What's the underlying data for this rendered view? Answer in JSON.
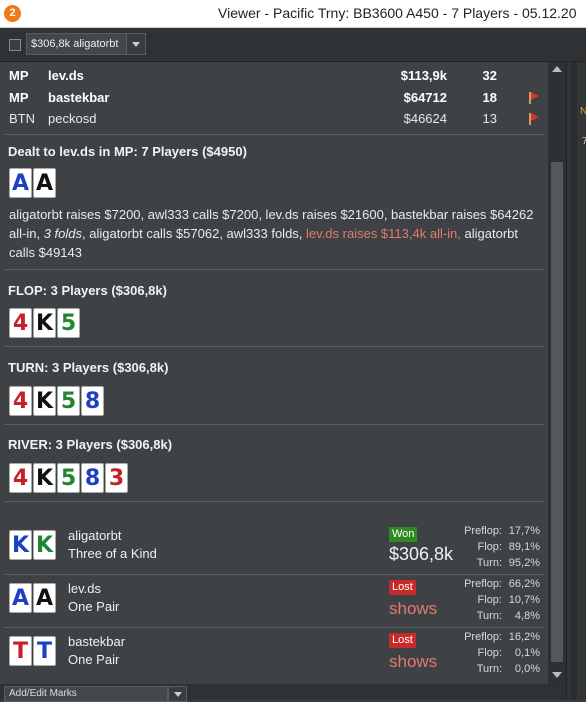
{
  "window": {
    "title": "Viewer - Pacific Trny: BB3600 A450 - 7 Players - 05.12.20",
    "app_icon": "2"
  },
  "toolbar": {
    "player_select": "$306,8k aligatorbt"
  },
  "players": [
    {
      "pos": "MP",
      "name": "lev.ds",
      "amount": "$113,9k",
      "num": "32",
      "bold": true,
      "flag": false
    },
    {
      "pos": "MP",
      "name": "bastekbar",
      "amount": "$64712",
      "num": "18",
      "bold": true,
      "flag": true
    },
    {
      "pos": "BTN",
      "name": "peckosd",
      "amount": "$46624",
      "num": "13",
      "bold": false,
      "flag": true
    }
  ],
  "preflop": {
    "title": "Dealt to lev.ds in MP: 7 Players ($4950)",
    "cards": [
      {
        "rank": "A",
        "color": "blue"
      },
      {
        "rank": "A",
        "color": "black"
      }
    ],
    "actions": {
      "part1": "aligatorbt raises $7200, awl333 calls $7200, lev.ds raises $21600, bastekbar raises $64262 all-in, ",
      "folds": "3 folds",
      "part2": ", aligatorbt calls $57062, awl333 folds, ",
      "hero": "lev.ds raises $113,4k all-in,",
      "part3": " aligatorbt calls $49143"
    }
  },
  "flop": {
    "title": "FLOP: 3 Players ($306,8k)",
    "cards": [
      {
        "rank": "4",
        "color": "red"
      },
      {
        "rank": "K",
        "color": "black"
      },
      {
        "rank": "5",
        "color": "green"
      }
    ]
  },
  "turn": {
    "title": "TURN: 3 Players ($306,8k)",
    "cards": [
      {
        "rank": "4",
        "color": "red"
      },
      {
        "rank": "K",
        "color": "black"
      },
      {
        "rank": "5",
        "color": "green"
      },
      {
        "rank": "8",
        "color": "blue"
      }
    ]
  },
  "river": {
    "title": "RIVER: 3 Players ($306,8k)",
    "cards": [
      {
        "rank": "4",
        "color": "red"
      },
      {
        "rank": "K",
        "color": "black"
      },
      {
        "rank": "5",
        "color": "green"
      },
      {
        "rank": "8",
        "color": "blue"
      },
      {
        "rank": "3",
        "color": "red"
      }
    ]
  },
  "results": [
    {
      "name": "aligatorbt",
      "hand": "Three of a Kind",
      "status": "Won",
      "amount": "$306,8k",
      "shows": "",
      "cards": [
        {
          "rank": "K",
          "color": "blue"
        },
        {
          "rank": "K",
          "color": "green"
        }
      ],
      "labels": {
        "preflop": "Preflop:",
        "flop": "Flop:",
        "turn": "Turn:"
      },
      "equity": {
        "preflop": "17,7%",
        "flop": "89,1%",
        "turn": "95,2%"
      }
    },
    {
      "name": "lev.ds",
      "hand": "One Pair",
      "status": "Lost",
      "amount": "",
      "shows": "shows",
      "cards": [
        {
          "rank": "A",
          "color": "blue"
        },
        {
          "rank": "A",
          "color": "black"
        }
      ],
      "labels": {
        "preflop": "Preflop:",
        "flop": "Flop:",
        "turn": "Turn:"
      },
      "equity": {
        "preflop": "66,2%",
        "flop": "10,7%",
        "turn": "4,8%"
      }
    },
    {
      "name": "bastekbar",
      "hand": "One Pair",
      "status": "Lost",
      "amount": "",
      "shows": "shows",
      "cards": [
        {
          "rank": "T",
          "color": "red"
        },
        {
          "rank": "T",
          "color": "blue"
        }
      ],
      "labels": {
        "preflop": "Preflop:",
        "flop": "Flop:",
        "turn": "Turn:"
      },
      "equity": {
        "preflop": "16,2%",
        "flop": "0,1%",
        "turn": "0,0%"
      }
    }
  ],
  "bottom": {
    "marks_select": "Add/Edit Marks"
  },
  "side_pane": {
    "label_n": "N",
    "label_7": "7"
  },
  "colors": {
    "blue": "#1d3fc4",
    "black": "#111111",
    "green": "#20862d",
    "red": "#c7202a",
    "won": "#2f8a24",
    "lost": "#c82a2a"
  }
}
